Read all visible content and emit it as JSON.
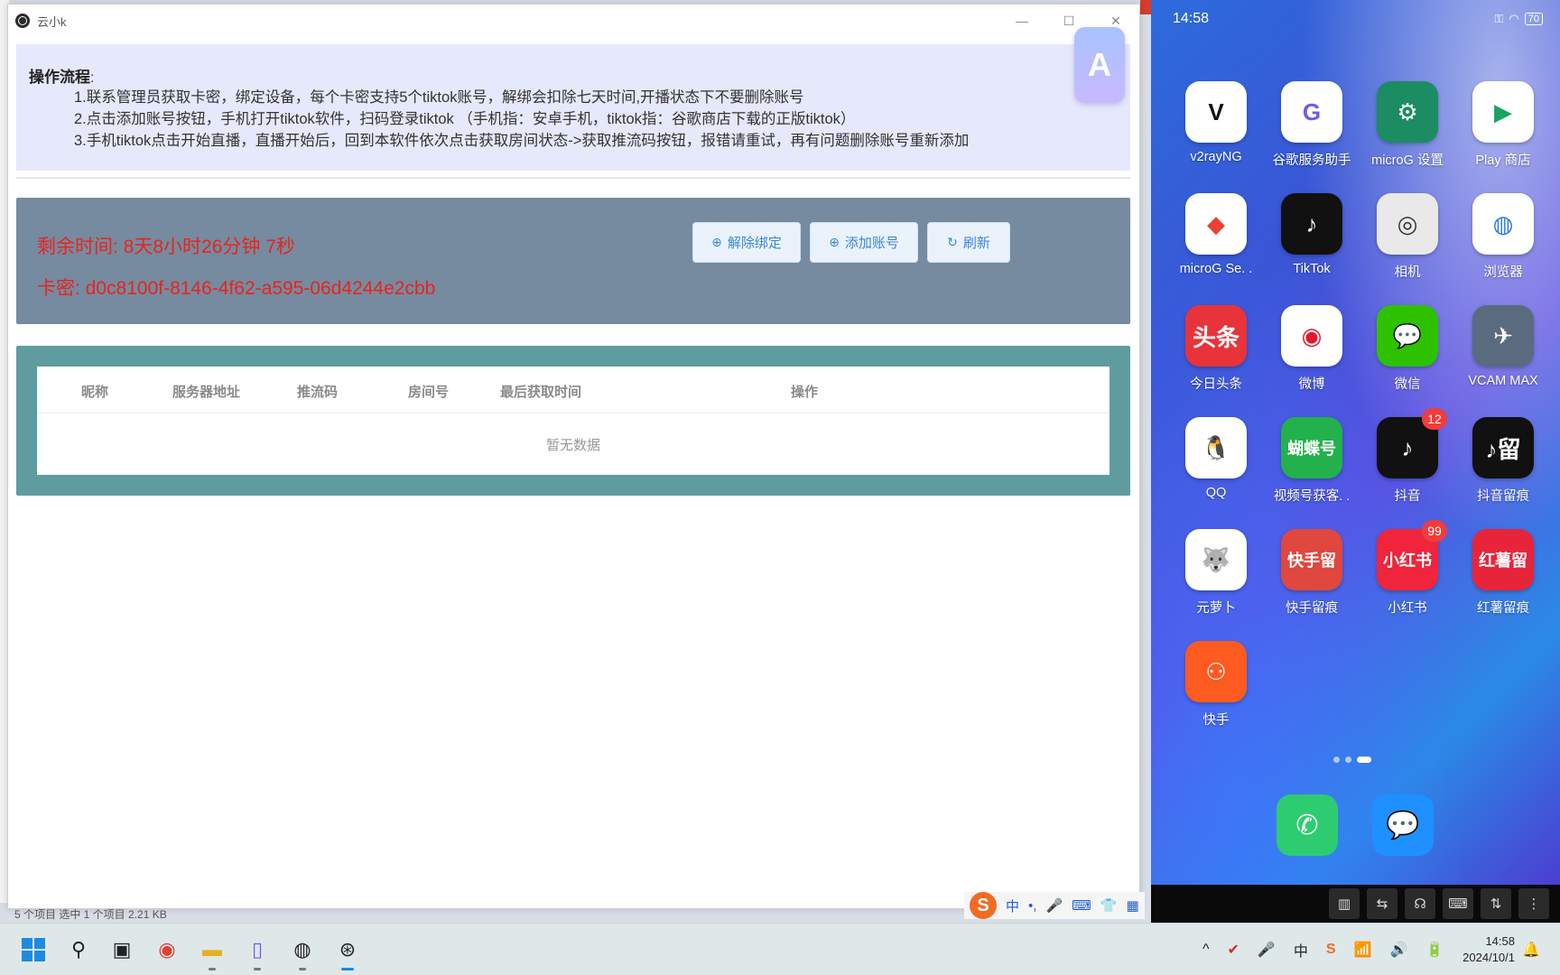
{
  "window": {
    "title": "云小k",
    "controls": {
      "minimize": "—",
      "maximize": "☐",
      "close": "✕"
    }
  },
  "floating_badge": {
    "glyph": "A"
  },
  "instructions": {
    "title": "操作流程",
    "title_suffix": ":",
    "lines": [
      "1.联系管理员获取卡密，绑定设备，每个卡密支持5个tiktok账号，解绑会扣除七天时间,开播状态下不要删除账号",
      "2.点击添加账号按钮，手机打开tiktok软件，扫码登录tiktok （手机指：安卓手机，tiktok指：谷歌商店下载的正版tiktok）",
      "3.手机tiktok点击开始直播，直播开始后，回到本软件依次点击获取房间状态->获取推流码按钮，报错请重试，再有问题删除账号重新添加"
    ]
  },
  "status": {
    "remaining": "剩余时间: 8天8小时26分钟 7秒",
    "card_key": "卡密: d0c8100f-8146-4f62-a595-06d4244e2cbb",
    "buttons": {
      "unbind": {
        "icon": "⊕",
        "label": "解除绑定"
      },
      "add_account": {
        "icon": "⊕",
        "label": "添加账号"
      },
      "refresh": {
        "icon": "↻",
        "label": "刷新"
      }
    },
    "colors": {
      "panel": "#768aa0",
      "text": "#e8241c"
    }
  },
  "table": {
    "columns": [
      "昵称",
      "服务器地址",
      "推流码",
      "房间号",
      "最后获取时间",
      "操作"
    ],
    "rows": [],
    "empty_text": "暂无数据"
  },
  "explorer_status": "5 个项目    选中 1 个项目  2.21 KB",
  "ime": {
    "logo": "S",
    "mode": "中",
    "punct": "•,",
    "mic": "🎤",
    "keyboard": "⌨",
    "skin": "👕",
    "menu": "▦"
  },
  "phone": {
    "time": "14:58",
    "battery": "70",
    "apps": [
      {
        "label": "v2rayNG",
        "glyph": "V",
        "color": "#ffffff",
        "fg": "#111"
      },
      {
        "label": "谷歌服务助手",
        "glyph": "G",
        "color": "#ffffff",
        "fg": "#6a5cf0"
      },
      {
        "label": "microG 设置",
        "glyph": "⚙",
        "color": "#1c8c63",
        "fg": "#fff"
      },
      {
        "label": "Play 商店",
        "glyph": "▶",
        "color": "#ffffff",
        "fg": "#1aa260"
      },
      {
        "label": "microG Se. .",
        "glyph": "◆",
        "color": "#ffffff",
        "fg": "#e94235"
      },
      {
        "label": "TikTok",
        "glyph": "♪",
        "color": "#111111",
        "fg": "#fff"
      },
      {
        "label": "相机",
        "glyph": "◎",
        "color": "#e9e9e9",
        "fg": "#333"
      },
      {
        "label": "浏览器",
        "glyph": "◍",
        "color": "#ffffff",
        "fg": "#2d7be0"
      },
      {
        "label": "今日头条",
        "glyph": "头条",
        "color": "#e8333a",
        "fg": "#fff"
      },
      {
        "label": "微博",
        "glyph": "◉",
        "color": "#ffffff",
        "fg": "#e6162d"
      },
      {
        "label": "微信",
        "glyph": "💬",
        "color": "#2dc100",
        "fg": "#fff"
      },
      {
        "label": "VCAM MAX",
        "glyph": "✈",
        "color": "#5a6b80",
        "fg": "#fff"
      },
      {
        "label": "QQ",
        "glyph": "🐧",
        "color": "#ffffff",
        "fg": "#111"
      },
      {
        "label": "视频号获客. .",
        "glyph": "蝴蝶号",
        "color": "#23b14d",
        "fg": "#fff"
      },
      {
        "label": "抖音",
        "glyph": "♪",
        "color": "#111111",
        "fg": "#fff",
        "badge": "12"
      },
      {
        "label": "抖音留痕",
        "glyph": "♪留",
        "color": "#111111",
        "fg": "#fff"
      },
      {
        "label": "元萝卜",
        "glyph": "🐺",
        "color": "#ffffff",
        "fg": "#333"
      },
      {
        "label": "快手留痕",
        "glyph": "快手留",
        "color": "#e0473e",
        "fg": "#fff"
      },
      {
        "label": "小红书",
        "glyph": "小红书",
        "color": "#f0243a",
        "fg": "#fff",
        "badge": "99"
      },
      {
        "label": "红薯留痕",
        "glyph": "红薯留",
        "color": "#e8243a",
        "fg": "#fff"
      },
      {
        "label": "快手",
        "glyph": "⚇",
        "color": "#ff5a1f",
        "fg": "#fff"
      }
    ],
    "dock": [
      {
        "name": "phone",
        "glyph": "✆",
        "color": "#2ecc71"
      },
      {
        "name": "messages",
        "glyph": "💬",
        "color": "#1e90ff"
      }
    ],
    "toolbar": [
      "▥",
      "⇆",
      "☊",
      "⌨",
      "⇅",
      "⋮"
    ]
  },
  "taskbar": {
    "clock_time": "14:58",
    "clock_date": "2024/10/1",
    "tray": [
      "^",
      "✔",
      "🎤",
      "中",
      "S",
      "📶",
      "🔊",
      "🔋"
    ],
    "notification": "🔔"
  }
}
